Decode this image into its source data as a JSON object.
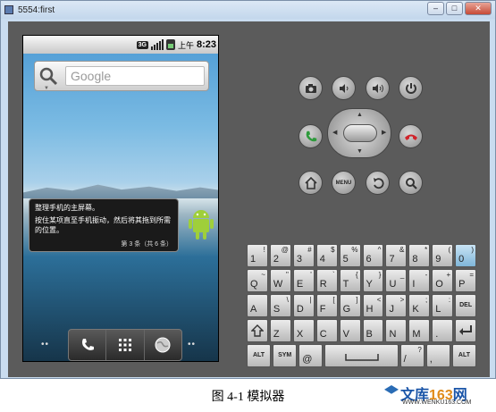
{
  "window": {
    "title": "5554:first",
    "buttons": {
      "minimize": "–",
      "maximize": "□",
      "close": "✕"
    }
  },
  "status_bar": {
    "net": "3G",
    "ampm": "上午",
    "time": "8:23"
  },
  "search_widget": {
    "placeholder": "Google"
  },
  "tip": {
    "line1": "整理手机的主屏幕。",
    "line2": "按住某项直至手机振动，然后将其拖到所需的位置。",
    "count": "第 3 条（共 6 条）"
  },
  "hw_buttons": {
    "menu_label": "MENU"
  },
  "keyboard": {
    "rows": [
      [
        {
          "m": "1",
          "a": "!"
        },
        {
          "m": "2",
          "a": "@"
        },
        {
          "m": "3",
          "a": "#"
        },
        {
          "m": "4",
          "a": "$"
        },
        {
          "m": "5",
          "a": "%"
        },
        {
          "m": "6",
          "a": "^"
        },
        {
          "m": "7",
          "a": "&"
        },
        {
          "m": "8",
          "a": "*"
        },
        {
          "m": "9",
          "a": "("
        },
        {
          "m": "0",
          "a": ")",
          "hl": true
        }
      ],
      [
        {
          "m": "Q",
          "a": "~"
        },
        {
          "m": "W",
          "a": "\""
        },
        {
          "m": "E",
          "a": "'"
        },
        {
          "m": "R",
          "a": "`"
        },
        {
          "m": "T",
          "a": "{"
        },
        {
          "m": "Y",
          "a": "}"
        },
        {
          "m": "U",
          "a": "_"
        },
        {
          "m": "I",
          "a": "-"
        },
        {
          "m": "O",
          "a": "+"
        },
        {
          "m": "P",
          "a": "="
        }
      ],
      [
        {
          "m": "A",
          "a": ""
        },
        {
          "m": "S",
          "a": "\\"
        },
        {
          "m": "D",
          "a": "|"
        },
        {
          "m": "F",
          "a": "["
        },
        {
          "m": "G",
          "a": "]"
        },
        {
          "m": "H",
          "a": "<"
        },
        {
          "m": "J",
          "a": ">"
        },
        {
          "m": "K",
          "a": ";"
        },
        {
          "m": "L",
          "a": ":"
        },
        {
          "c": "DEL"
        }
      ],
      [
        {
          "icon": "shift"
        },
        {
          "m": "Z",
          "a": ""
        },
        {
          "m": "X",
          "a": ""
        },
        {
          "m": "C",
          "a": ""
        },
        {
          "m": "V",
          "a": ""
        },
        {
          "m": "B",
          "a": ""
        },
        {
          "m": "N",
          "a": ""
        },
        {
          "m": "M",
          "a": ""
        },
        {
          "m": ".",
          "a": ""
        },
        {
          "icon": "enter"
        }
      ],
      [
        {
          "c": "ALT"
        },
        {
          "c": "SYM"
        },
        {
          "m": "@",
          "a": ""
        },
        {
          "space": true
        },
        {
          "m": "/",
          "a": "?"
        },
        {
          "m": ",",
          "a": ""
        },
        {
          "c": "ALT"
        }
      ]
    ]
  },
  "caption": "图 4-1  模拟器",
  "watermark": {
    "brand": "文库",
    "num": "163",
    "suffix": "网",
    "url": "WWW.WENKU163.COM"
  }
}
